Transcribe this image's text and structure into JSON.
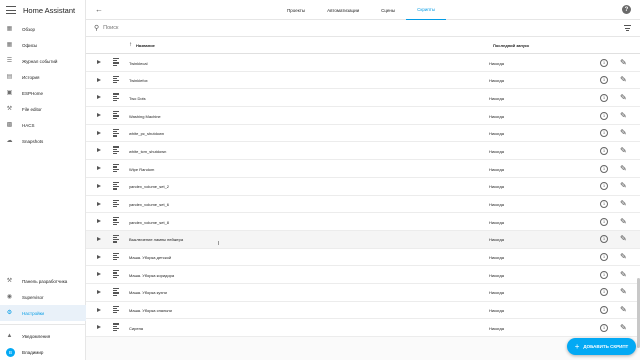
{
  "sidebar": {
    "title": "Home Assistant",
    "items": [
      {
        "label": "Обзор",
        "icon": "dashboard-icon"
      },
      {
        "label": "Офисы",
        "icon": "dashboard-icon"
      },
      {
        "label": "Журнал событий",
        "icon": "list-icon"
      },
      {
        "label": "История",
        "icon": "chart-icon"
      },
      {
        "label": "ESPHome",
        "icon": "esphome-icon"
      },
      {
        "label": "File editor",
        "icon": "wrench-icon"
      },
      {
        "label": "HACS",
        "icon": "hacs-icon"
      },
      {
        "label": "Snapshots",
        "icon": "cloud-icon"
      }
    ],
    "bottom_items": [
      {
        "label": "Панель разработчика",
        "icon": "hammer-icon"
      },
      {
        "label": "Supervisor",
        "icon": "supervisor-icon"
      },
      {
        "label": "Настройки",
        "icon": "gear-icon",
        "active": true
      }
    ],
    "notifications_label": "Уведомления",
    "user": {
      "name": "Владимир",
      "initial": "В"
    }
  },
  "topbar": {
    "tabs": [
      {
        "label": "Проекты",
        "active": false
      },
      {
        "label": "Автоматизации",
        "active": false
      },
      {
        "label": "Сцены",
        "active": false
      },
      {
        "label": "Скрипты",
        "active": true
      }
    ]
  },
  "search": {
    "placeholder": "Поиск"
  },
  "table": {
    "columns": {
      "name": "Название",
      "last_run": "Последний запуск"
    },
    "rows": [
      {
        "name": "Twinklecal",
        "last_run": "Никогда"
      },
      {
        "name": "Twinklefox",
        "last_run": "Никогда"
      },
      {
        "name": "Two Dots",
        "last_run": "Никогда"
      },
      {
        "name": "Washing Machine",
        "last_run": "Никогда"
      },
      {
        "name": "white_pc_shutdown",
        "last_run": "Никогда"
      },
      {
        "name": "white_tcm_shutdown",
        "last_run": "Никогда"
      },
      {
        "name": "Wipe Random",
        "last_run": "Никогда"
      },
      {
        "name": "yandex_volume_set_2",
        "last_run": "Никогда"
      },
      {
        "name": "yandex_volume_set_6",
        "last_run": "Никогда"
      },
      {
        "name": "yandex_volume_set_8",
        "last_run": "Никогда"
      },
      {
        "name": "Выключение лампы пейжера",
        "last_run": "Никогда"
      },
      {
        "name": "Маша. Уборка детской",
        "last_run": "Никогда"
      },
      {
        "name": "Маша. Уборка коридора",
        "last_run": "Никогда"
      },
      {
        "name": "Маша. Уборка кухни",
        "last_run": "Никогда"
      },
      {
        "name": "Маша. Уборка спальни",
        "last_run": "Никогда"
      },
      {
        "name": "Сирена",
        "last_run": "Никогда"
      }
    ]
  },
  "fab": {
    "label": "ДОБАВИТЬ СКРИПТ"
  },
  "colors": {
    "accent": "#03a9f4",
    "active_bg": "#e9f1f9"
  }
}
